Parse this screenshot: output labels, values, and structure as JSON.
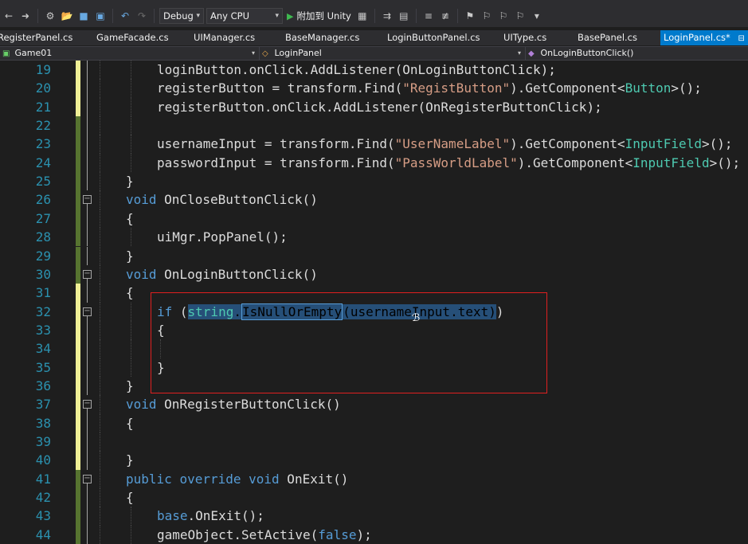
{
  "toolbar": {
    "configuration": "Debug",
    "platform": "Any CPU",
    "attach_label": "附加到 Unity"
  },
  "tabs": [
    {
      "label": "RegisterPanel.cs",
      "active": false
    },
    {
      "label": "GameFacade.cs",
      "active": false
    },
    {
      "label": "UIManager.cs",
      "active": false
    },
    {
      "label": "BaseManager.cs",
      "active": false
    },
    {
      "label": "LoginButtonPanel.cs",
      "active": false
    },
    {
      "label": "UIType.cs",
      "active": false
    },
    {
      "label": "BasePanel.cs",
      "active": false
    },
    {
      "label": "LoginPanel.cs*",
      "active": true
    }
  ],
  "navbar": {
    "project": "Game01",
    "class": "LoginPanel",
    "member": "OnLoginButtonClick()"
  },
  "editor": {
    "lines": [
      {
        "number": "19",
        "tokens": [
          [
            "plain",
            "loginButton.onClick.AddListener(OnLoginButtonClick);"
          ]
        ]
      },
      {
        "number": "20",
        "tokens": [
          [
            "plain",
            "registerButton = transform.Find("
          ],
          [
            "str",
            "\"RegistButton\""
          ],
          [
            "plain",
            ").GetComponent<"
          ],
          [
            "type",
            "Button"
          ],
          [
            "plain",
            ">();"
          ]
        ]
      },
      {
        "number": "21",
        "tokens": [
          [
            "plain",
            "registerButton.onClick.AddListener(OnRegisterButtonClick);"
          ]
        ]
      },
      {
        "number": "22",
        "tokens": []
      },
      {
        "number": "23",
        "tokens": [
          [
            "plain",
            "usernameInput = transform.Find("
          ],
          [
            "str",
            "\"UserNameLabel\""
          ],
          [
            "plain",
            ").GetComponent<"
          ],
          [
            "type",
            "InputField"
          ],
          [
            "plain",
            ">();"
          ]
        ]
      },
      {
        "number": "24",
        "tokens": [
          [
            "plain",
            "passwordInput = transform.Find("
          ],
          [
            "str",
            "\"PassWorldLabel\""
          ],
          [
            "plain",
            ").GetComponent<"
          ],
          [
            "type",
            "InputField"
          ],
          [
            "plain",
            ">();"
          ]
        ]
      },
      {
        "number": "25",
        "tokens": [
          [
            "plain",
            "}"
          ]
        ]
      },
      {
        "number": "26",
        "tokens": [
          [
            "kw",
            "void"
          ],
          [
            "plain",
            " OnCloseButtonClick()"
          ]
        ]
      },
      {
        "number": "27",
        "tokens": [
          [
            "plain",
            "{"
          ]
        ]
      },
      {
        "number": "28",
        "tokens": [
          [
            "plain",
            "uiMgr.PopPanel();"
          ]
        ]
      },
      {
        "number": "29",
        "tokens": [
          [
            "plain",
            "}"
          ]
        ]
      },
      {
        "number": "30",
        "tokens": [
          [
            "kw",
            "void"
          ],
          [
            "plain",
            " OnLoginButtonClick()"
          ]
        ]
      },
      {
        "number": "31",
        "tokens": [
          [
            "plain",
            "{"
          ]
        ]
      },
      {
        "number": "32",
        "tokens": [
          [
            "kw",
            "if"
          ],
          [
            "plain",
            " ("
          ],
          [
            "kw_sel",
            "string"
          ],
          [
            "sel",
            "."
          ],
          [
            "sel_strong",
            "IsNullOrEmpty"
          ],
          [
            "sel",
            "(usernameInput.text)"
          ],
          [
            "plain",
            ")"
          ]
        ]
      },
      {
        "number": "33",
        "tokens": [
          [
            "plain",
            "{"
          ]
        ]
      },
      {
        "number": "34",
        "tokens": []
      },
      {
        "number": "35",
        "tokens": [
          [
            "plain",
            "}"
          ]
        ]
      },
      {
        "number": "36",
        "tokens": [
          [
            "plain",
            "}"
          ]
        ]
      },
      {
        "number": "37",
        "tokens": [
          [
            "kw",
            "void"
          ],
          [
            "plain",
            " OnRegisterButtonClick()"
          ]
        ]
      },
      {
        "number": "38",
        "tokens": [
          [
            "plain",
            "{"
          ]
        ]
      },
      {
        "number": "39",
        "tokens": []
      },
      {
        "number": "40",
        "tokens": [
          [
            "plain",
            "}"
          ]
        ]
      },
      {
        "number": "41",
        "tokens": [
          [
            "kw",
            "public"
          ],
          [
            "plain",
            " "
          ],
          [
            "kw",
            "override"
          ],
          [
            "plain",
            " "
          ],
          [
            "kw",
            "void"
          ],
          [
            "plain",
            " OnExit()"
          ]
        ]
      },
      {
        "number": "42",
        "tokens": [
          [
            "plain",
            "{"
          ]
        ]
      },
      {
        "number": "43",
        "tokens": [
          [
            "kw",
            "base"
          ],
          [
            "plain",
            ".OnExit();"
          ]
        ]
      },
      {
        "number": "44",
        "tokens": [
          [
            "plain",
            "gameObject.SetActive("
          ],
          [
            "kw",
            "false"
          ],
          [
            "plain",
            ");"
          ]
        ]
      }
    ]
  },
  "colors": {
    "background": "#1e1e1e",
    "keyword": "#569cd6",
    "string": "#d69d85",
    "type": "#4ec9b0",
    "line_number": "#2b91af",
    "active_tab": "#007acc",
    "annotation": "#e02020"
  }
}
